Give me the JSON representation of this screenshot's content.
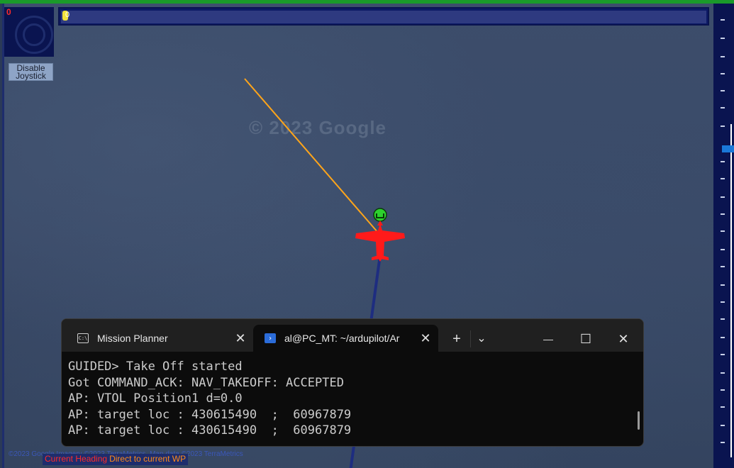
{
  "joystick": {
    "count": "0",
    "button_label": "Disable Joystick"
  },
  "progress": {
    "label": "0",
    "value": 0
  },
  "map": {
    "watermark": "© 2023 Google",
    "copyright": "©2023 Google Imagery ©2023 TerraMetrics, Map data ©2023 TerraMetrics",
    "status_heading": "Current Heading",
    "status_direct": "Direct to current WP"
  },
  "terminal": {
    "tabs": [
      {
        "title": "Mission Planner",
        "icon": "cmd-icon"
      },
      {
        "title": "al@PC_MT: ~/ardupilot/Ar",
        "icon": "powershell-icon"
      }
    ],
    "new_tab": "+",
    "dropdown": "⌄",
    "minimize": "—",
    "maximize": "☐",
    "close": "✕",
    "lines": [
      "GUIDED> Take Off started",
      "Got COMMAND_ACK: NAV_TAKEOFF: ACCEPTED",
      "AP: VTOL Position1 d=0.0",
      "AP: target loc : 430615490  ;  60967879",
      "AP: target loc : 430615490  ;  60967879"
    ]
  },
  "colors": {
    "heading_line": "#ffa51a",
    "track_line": "#1e2d80",
    "plane": "#ff1a1a",
    "home_marker": "#2dd12d"
  }
}
